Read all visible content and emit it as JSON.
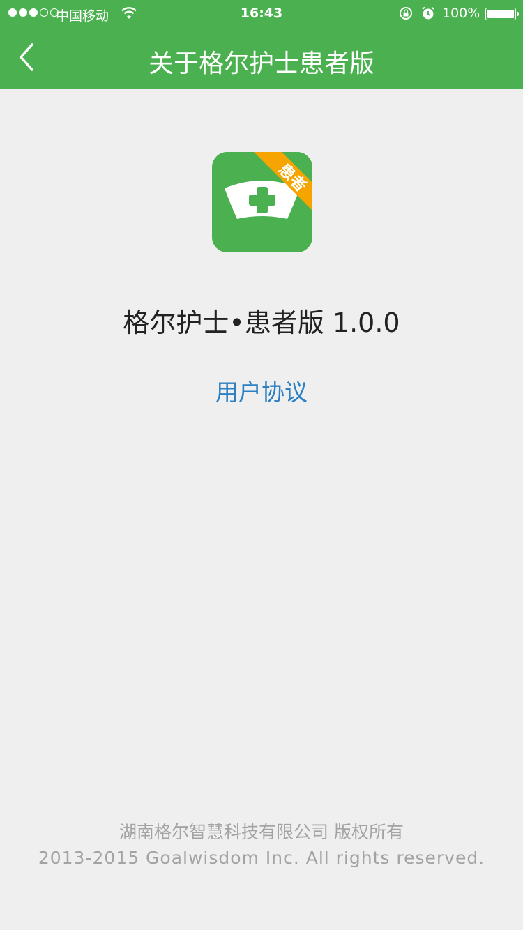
{
  "status_bar": {
    "carrier": "中国移动",
    "time": "16:43",
    "battery_percent": "100%"
  },
  "nav": {
    "title": "关于格尔护士患者版",
    "back_icon": "chevron-left-icon"
  },
  "app": {
    "badge_text": "患者",
    "version_text": "格尔护士•患者版 1.0.0",
    "agreement_link": "用户协议"
  },
  "footer": {
    "company": "湖南格尔智慧科技有限公司 版权所有",
    "copyright": "2013-2015 Goalwisdom Inc. All rights reserved."
  },
  "colors": {
    "header_green": "#4bb04f",
    "badge_orange": "#f5a400",
    "link_blue": "#2b7fc3",
    "background": "#efefef"
  }
}
